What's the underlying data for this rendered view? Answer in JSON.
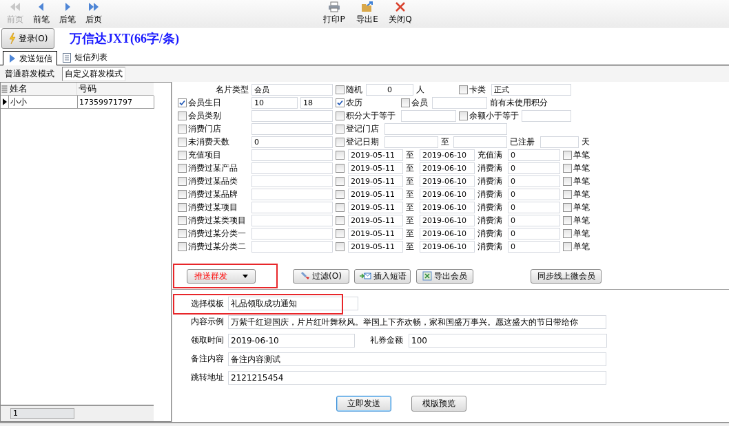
{
  "toolbar": {
    "nav": [
      {
        "kind": "first",
        "label": "前页",
        "disabled": true
      },
      {
        "kind": "prev",
        "label": "前笔",
        "disabled": false
      },
      {
        "kind": "next",
        "label": "后笔",
        "disabled": false
      },
      {
        "kind": "last",
        "label": "后页",
        "disabled": false
      }
    ],
    "actions": [
      {
        "kind": "print",
        "label": "打印P"
      },
      {
        "kind": "export",
        "label": "导出E"
      },
      {
        "kind": "close",
        "label": "关闭Q"
      }
    ]
  },
  "login_button": "登录(O)",
  "app_title": "万信达JXT(66字/条)",
  "tabs": [
    {
      "kind": "send",
      "label": "发送短信",
      "selected": true
    },
    {
      "kind": "list",
      "label": "短信列表",
      "selected": false
    }
  ],
  "modes": [
    {
      "label": "普通群发模式",
      "selected": false
    },
    {
      "label": "自定义群发模式",
      "selected": true
    }
  ],
  "contacts": {
    "columns": [
      "姓名",
      "号码"
    ],
    "rows": [
      {
        "cells": [
          "小小",
          "17359971797"
        ],
        "selected": true
      }
    ],
    "footer": "1"
  },
  "filters": [
    {
      "kind": "header",
      "items": [
        {
          "kind": "label",
          "text": "名片类型"
        },
        {
          "kind": "field",
          "value": "会员"
        },
        {
          "kind": "check",
          "label": "随机",
          "checked": false
        },
        {
          "kind": "field",
          "value": "0"
        },
        {
          "kind": "text",
          "text": "人"
        },
        {
          "kind": "check",
          "label": "卡类",
          "checked": false
        },
        {
          "kind": "field",
          "value": "正式"
        }
      ]
    },
    {
      "kind": "birthday",
      "items": [
        {
          "kind": "check",
          "label": "会员生日",
          "checked": true
        },
        {
          "kind": "field",
          "value": "10"
        },
        {
          "kind": "field",
          "value": "18"
        },
        {
          "kind": "check",
          "label": "农历",
          "checked": true
        },
        {
          "kind": "check",
          "label": "会员",
          "checked": false
        },
        {
          "kind": "field"
        },
        {
          "kind": "text",
          "text": "前有未使用积分"
        }
      ]
    },
    {
      "kind": "points",
      "items": [
        {
          "kind": "check",
          "label": "会员类别",
          "checked": false
        },
        {
          "kind": "field"
        },
        {
          "kind": "check",
          "label": "积分大于等于",
          "checked": false
        },
        {
          "kind": "field"
        },
        {
          "kind": "check",
          "label": "余额小于等于",
          "checked": false
        },
        {
          "kind": "field"
        }
      ]
    },
    {
      "kind": "store",
      "items": [
        {
          "kind": "check",
          "label": "消费门店",
          "checked": false
        },
        {
          "kind": "field"
        },
        {
          "kind": "check",
          "label": "登记门店",
          "checked": false
        },
        {
          "kind": "field"
        }
      ]
    },
    {
      "kind": "days",
      "items": [
        {
          "kind": "check",
          "label": "未消费天数",
          "checked": false
        },
        {
          "kind": "field",
          "value": "0"
        },
        {
          "kind": "check",
          "label": "登记日期",
          "checked": false
        },
        {
          "kind": "field"
        },
        {
          "kind": "text",
          "text": "至"
        },
        {
          "kind": "field"
        },
        {
          "kind": "text",
          "text": "已注册"
        },
        {
          "kind": "field"
        },
        {
          "kind": "text",
          "text": "天"
        }
      ]
    },
    {
      "kind": "range",
      "items": [
        {
          "kind": "check",
          "label": "充值项目",
          "checked": false
        },
        {
          "kind": "field"
        },
        {
          "kind": "check",
          "checked": false
        },
        {
          "kind": "field",
          "value": "2019-05-11"
        },
        {
          "kind": "text",
          "text": "至"
        },
        {
          "kind": "field",
          "value": "2019-06-10"
        },
        {
          "kind": "text",
          "text": "充值满"
        },
        {
          "kind": "field",
          "value": "0"
        },
        {
          "kind": "check",
          "label": "单笔",
          "checked": false
        }
      ]
    },
    {
      "kind": "range",
      "items": [
        {
          "kind": "check",
          "label": "消费过某产品",
          "checked": false
        },
        {
          "kind": "field"
        },
        {
          "kind": "check",
          "checked": false
        },
        {
          "kind": "field",
          "value": "2019-05-11"
        },
        {
          "kind": "text",
          "text": "至"
        },
        {
          "kind": "field",
          "value": "2019-06-10"
        },
        {
          "kind": "text",
          "text": "消费满"
        },
        {
          "kind": "field",
          "value": "0"
        },
        {
          "kind": "check",
          "label": "单笔",
          "checked": false
        }
      ]
    },
    {
      "kind": "range",
      "items": [
        {
          "kind": "check",
          "label": "消费过某品类",
          "checked": false
        },
        {
          "kind": "field"
        },
        {
          "kind": "check",
          "checked": false
        },
        {
          "kind": "field",
          "value": "2019-05-11"
        },
        {
          "kind": "text",
          "text": "至"
        },
        {
          "kind": "field",
          "value": "2019-06-10"
        },
        {
          "kind": "text",
          "text": "消费满"
        },
        {
          "kind": "field",
          "value": "0"
        },
        {
          "kind": "check",
          "label": "单笔",
          "checked": false
        }
      ]
    },
    {
      "kind": "range",
      "items": [
        {
          "kind": "check",
          "label": "消费过某品牌",
          "checked": false
        },
        {
          "kind": "field"
        },
        {
          "kind": "check",
          "checked": false
        },
        {
          "kind": "field",
          "value": "2019-05-11"
        },
        {
          "kind": "text",
          "text": "至"
        },
        {
          "kind": "field",
          "value": "2019-06-10"
        },
        {
          "kind": "text",
          "text": "消费满"
        },
        {
          "kind": "field",
          "value": "0"
        },
        {
          "kind": "check",
          "label": "单笔",
          "checked": false
        }
      ]
    },
    {
      "kind": "range",
      "items": [
        {
          "kind": "check",
          "label": "消费过某项目",
          "checked": false
        },
        {
          "kind": "field"
        },
        {
          "kind": "check",
          "checked": false
        },
        {
          "kind": "field",
          "value": "2019-05-11"
        },
        {
          "kind": "text",
          "text": "至"
        },
        {
          "kind": "field",
          "value": "2019-06-10"
        },
        {
          "kind": "text",
          "text": "消费满"
        },
        {
          "kind": "field",
          "value": "0"
        },
        {
          "kind": "check",
          "label": "单笔",
          "checked": false
        }
      ]
    },
    {
      "kind": "range",
      "items": [
        {
          "kind": "check",
          "label": "消费过某类项目",
          "checked": false
        },
        {
          "kind": "field"
        },
        {
          "kind": "check",
          "checked": false
        },
        {
          "kind": "field",
          "value": "2019-05-11"
        },
        {
          "kind": "text",
          "text": "至"
        },
        {
          "kind": "field",
          "value": "2019-06-10"
        },
        {
          "kind": "text",
          "text": "消费满"
        },
        {
          "kind": "field",
          "value": "0"
        },
        {
          "kind": "check",
          "label": "单笔",
          "checked": false
        }
      ]
    },
    {
      "kind": "range",
      "items": [
        {
          "kind": "check",
          "label": "消费过某分类一",
          "checked": false
        },
        {
          "kind": "field"
        },
        {
          "kind": "check",
          "checked": false
        },
        {
          "kind": "field",
          "value": "2019-05-11"
        },
        {
          "kind": "text",
          "text": "至"
        },
        {
          "kind": "field",
          "value": "2019-06-10"
        },
        {
          "kind": "text",
          "text": "消费满"
        },
        {
          "kind": "field",
          "value": "0"
        },
        {
          "kind": "check",
          "label": "单笔",
          "checked": false
        }
      ]
    },
    {
      "kind": "range",
      "items": [
        {
          "kind": "check",
          "label": "消费过某分类二",
          "checked": false
        },
        {
          "kind": "field"
        },
        {
          "kind": "check",
          "checked": false
        },
        {
          "kind": "field",
          "value": "2019-05-11"
        },
        {
          "kind": "text",
          "text": "至"
        },
        {
          "kind": "field",
          "value": "2019-06-10"
        },
        {
          "kind": "text",
          "text": "消费满"
        },
        {
          "kind": "field",
          "value": "0"
        },
        {
          "kind": "check",
          "label": "单笔",
          "checked": false
        }
      ]
    }
  ],
  "actions": [
    {
      "kind": "dropdown",
      "label": "推送群发"
    },
    {
      "kind": "filter",
      "label": "过滤(O)"
    },
    {
      "kind": "phrase",
      "label": "插入短语"
    },
    {
      "kind": "export",
      "label": "导出会员"
    },
    {
      "kind": "plain",
      "label": "同步线上微会员"
    }
  ],
  "template": [
    {
      "kind": "short",
      "label": "选择模板",
      "value": "礼品领取成功通知"
    },
    {
      "kind": "full",
      "label": "内容示例",
      "value": "万紫千红迎国庆，片片红叶舞秋风。举国上下齐欢畅，家和国盛万事兴。愿这盛大的节日带给你"
    },
    {
      "kind": "pair",
      "label": "领取时间",
      "value": "2019-06-10",
      "label2": "礼券金额",
      "value2": "100"
    },
    {
      "kind": "full",
      "label": "备注内容",
      "value": "备注内容测试"
    },
    {
      "kind": "full",
      "label": "跳转地址",
      "value": "2121215454"
    }
  ],
  "buttons": [
    {
      "label": "立即发送",
      "focused": true
    },
    {
      "label": "模版预览",
      "focused": false
    }
  ]
}
